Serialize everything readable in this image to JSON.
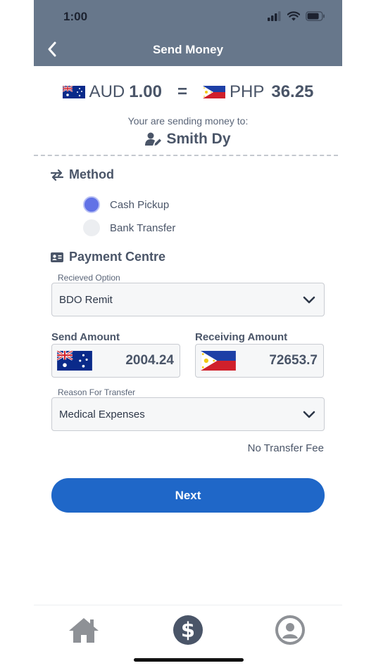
{
  "status_bar": {
    "time": "1:00"
  },
  "header": {
    "title": "Send Money"
  },
  "rate": {
    "from_currency": "AUD",
    "from_amount": "1.00",
    "equals": "=",
    "to_currency": "PHP",
    "to_amount": "36.25"
  },
  "recipient": {
    "caption": "Your are sending money to:",
    "name": "Smith Dy"
  },
  "method": {
    "title": "Method",
    "options": [
      {
        "label": "Cash Pickup",
        "selected": true
      },
      {
        "label": "Bank Transfer",
        "selected": false
      }
    ]
  },
  "payment_centre": {
    "title": "Payment Centre",
    "received_option_label": "Recieved Option",
    "received_option_value": "BDO Remit"
  },
  "amounts": {
    "send_label": "Send Amount",
    "send_value": "2004.24",
    "receive_label": "Receiving Amount",
    "receive_value": "72653.7"
  },
  "reason": {
    "label": "Reason For Transfer",
    "value": "Medical Expenses"
  },
  "fee_text": "No Transfer Fee",
  "next_label": "Next",
  "colors": {
    "header": "#67778b",
    "primary": "#1f67c8",
    "radio_on": "#6172e6",
    "text": "#4a5568"
  },
  "tabbar": {
    "icons": [
      "home-icon",
      "dollar-icon",
      "profile-icon"
    ],
    "active": "dollar-icon"
  }
}
